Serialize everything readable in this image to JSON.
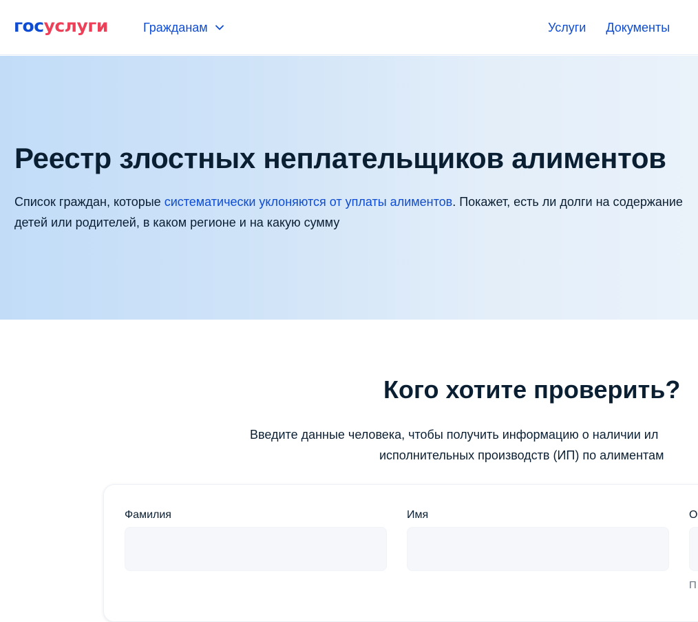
{
  "header": {
    "logo_part1": "гос",
    "logo_part2": "услуги",
    "citizens_label": "Гражданам",
    "nav": [
      "Услуги",
      "Документы"
    ]
  },
  "hero": {
    "title": "Реестр злостных неплательщиков алиментов",
    "desc_before": "Список граждан, которые ",
    "desc_link": "систематически уклоняются от уплаты алиментов",
    "desc_after": ". Покажет, есть ли долги на содержание детей или родителей, в каком регионе и на какую сумму"
  },
  "check": {
    "title": "Кого хотите проверить?",
    "subtitle_line1": "Введите данные человека, чтобы получить информацию о наличии ил",
    "subtitle_line2": "исполнительных производств (ИП) по алиментам"
  },
  "form": {
    "fields": [
      {
        "label": "Фамилия",
        "value": ""
      },
      {
        "label": "Имя",
        "value": ""
      },
      {
        "label": "О",
        "value": ""
      }
    ],
    "hint_fragment": "П"
  },
  "colors": {
    "brand_blue": "#0d4cd3",
    "brand_red": "#ee3f58",
    "text": "#0b1f33"
  }
}
